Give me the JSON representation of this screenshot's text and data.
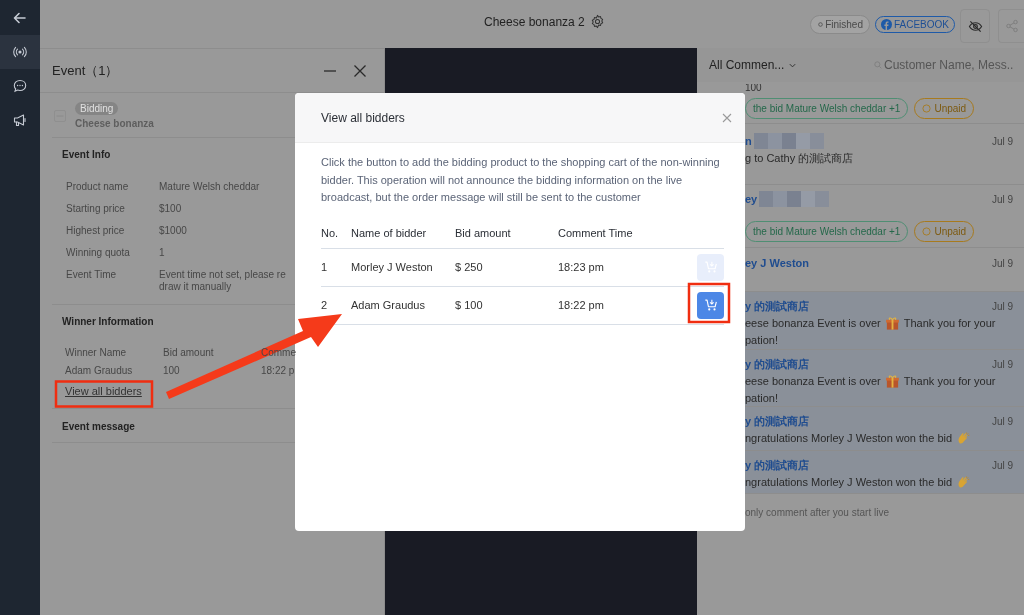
{
  "nav_rail": {
    "items": [
      {
        "kind": "back",
        "selected": false
      },
      {
        "kind": "live",
        "selected": true
      },
      {
        "kind": "chat",
        "selected": false
      },
      {
        "kind": "megaphone",
        "selected": false
      }
    ]
  },
  "top_bar": {
    "title": "Cheese bonanza 2",
    "status": "Finished",
    "platform": "FACEBOOK"
  },
  "event_panel": {
    "title": "Event（1）",
    "event": {
      "tag": "Bidding",
      "name": "Cheese bonanza"
    },
    "info_title": "Event Info",
    "info": [
      {
        "label": "Product name",
        "value": [
          "Mature Welsh cheddar"
        ]
      },
      {
        "label": "Starting price",
        "value": [
          "$100"
        ]
      },
      {
        "label": "Highest price",
        "value": [
          "$1000"
        ]
      },
      {
        "label": "Winning quota",
        "value": [
          "1"
        ]
      },
      {
        "label": "Event Time",
        "value": [
          "Event time not set, please re",
          "draw it manually"
        ]
      }
    ],
    "winner_title": "Winner Information",
    "winner_columns": [
      "Winner Name",
      "Bid amount",
      "Comme"
    ],
    "winner_row": [
      "Adam Graudus",
      "100",
      "18:22 p"
    ],
    "link": "View all bidders",
    "message_title": "Event message"
  },
  "comments": {
    "filter": "All Commen...",
    "search_placeholder": "Customer Name, Mess..",
    "items": [
      {
        "text": "100",
        "highlighted": false,
        "tags": [
          {
            "kind": "bid",
            "label": "the bid Mature Welsh cheddar +1"
          },
          {
            "kind": "payment",
            "label": "Unpaid"
          }
        ]
      },
      {
        "name": "n",
        "redacted": true,
        "date": "Jul 9",
        "highlighted": false,
        "message": {
          "before": "g to Cathy 的測試商店"
        }
      },
      {
        "name": "ey",
        "redacted": true,
        "date": "Jul 9",
        "highlighted": false,
        "tags": [
          {
            "kind": "bid",
            "label": "the bid Mature Welsh cheddar +1"
          },
          {
            "kind": "payment",
            "label": "Unpaid"
          }
        ]
      },
      {
        "name": "ey J Weston",
        "redacted": false,
        "date": "Jul 9",
        "highlighted": false
      },
      {
        "name": "y 的測試商店",
        "redacted": false,
        "date": "Jul 9",
        "highlighted": true,
        "message": {
          "kind": "gift",
          "before": "eese bonanza Event is over",
          "after": "Thank you for your",
          "continued": "pation!"
        }
      },
      {
        "name": "y 的測試商店",
        "redacted": false,
        "date": "Jul 9",
        "highlighted": true,
        "message": {
          "kind": "gift",
          "before": "eese bonanza Event is over",
          "after": "Thank you for your",
          "continued": "pation!"
        }
      },
      {
        "name": "y 的測試商店",
        "redacted": false,
        "date": "Jul 9",
        "highlighted": true,
        "message": {
          "kind": "clap",
          "before": "ngratulations Morley J Weston won the bid"
        }
      },
      {
        "name": "y 的測試商店",
        "redacted": false,
        "date": "Jul 9",
        "highlighted": true,
        "message": {
          "kind": "clap",
          "before": "ngratulations Morley J Weston won the bid"
        }
      }
    ],
    "input_placeholder": "only comment after you start live"
  },
  "modal": {
    "title": "View all bidders",
    "description": "Click the button to add the bidding product to the shopping cart of the non-winning bidder. This operation will not announce the bidding information on the live broadcast, but the order message will still be sent to the customer",
    "columns": [
      "No.",
      "Name of bidder",
      "Bid amount",
      "Comment Time"
    ],
    "rows": [
      {
        "no": "1",
        "name": "Morley J Weston",
        "amount": "$ 250",
        "time": "18:23 pm",
        "disabled": true
      },
      {
        "no": "2",
        "name": "Adam Graudus",
        "amount": "$ 100",
        "time": "18:22 pm",
        "disabled": false
      }
    ]
  }
}
